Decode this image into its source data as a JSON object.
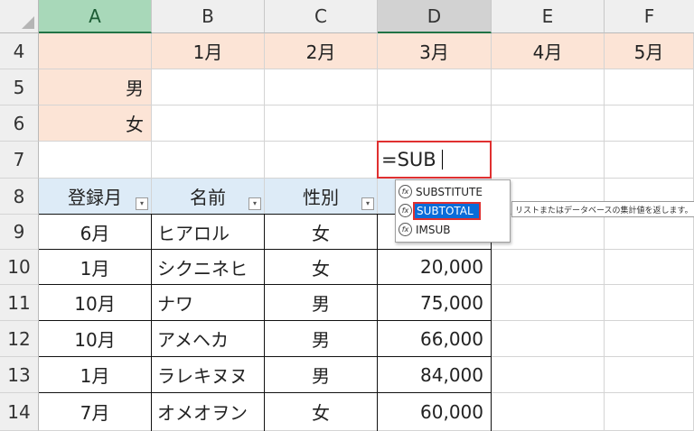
{
  "columns": [
    "A",
    "B",
    "C",
    "D",
    "E",
    "F"
  ],
  "rows": [
    "4",
    "5",
    "6",
    "7",
    "8",
    "9",
    "10",
    "11",
    "12",
    "13",
    "14"
  ],
  "header_row": {
    "B": "1月",
    "C": "2月",
    "D": "3月",
    "E": "4月",
    "F": "5月"
  },
  "labels": {
    "male": "男",
    "female": "女"
  },
  "formula_input": "=SUB",
  "table_headers": [
    "登録月",
    "名前",
    "性別"
  ],
  "table_rows": [
    {
      "month": "6月",
      "name": "ヒアロル",
      "gender": "女",
      "amount": ""
    },
    {
      "month": "1月",
      "name": "シクニネヒ",
      "gender": "女",
      "amount": "20,000"
    },
    {
      "month": "10月",
      "name": "ナワ",
      "gender": "男",
      "amount": "75,000"
    },
    {
      "month": "10月",
      "name": "アメヘカ",
      "gender": "男",
      "amount": "66,000"
    },
    {
      "month": "1月",
      "name": "ラレキヌヌ",
      "gender": "男",
      "amount": "84,000"
    },
    {
      "month": "7月",
      "name": "オメオヲン",
      "gender": "女",
      "amount": "60,000"
    }
  ],
  "autocomplete": {
    "items": [
      "SUBSTITUTE",
      "SUBTOTAL",
      "IMSUB"
    ],
    "selected_index": 1,
    "tooltip": "リストまたはデータベースの集計値を返します。"
  },
  "colors": {
    "accent": "#217346",
    "highlight": "#0a6cd9",
    "annotation": "#e03030"
  }
}
